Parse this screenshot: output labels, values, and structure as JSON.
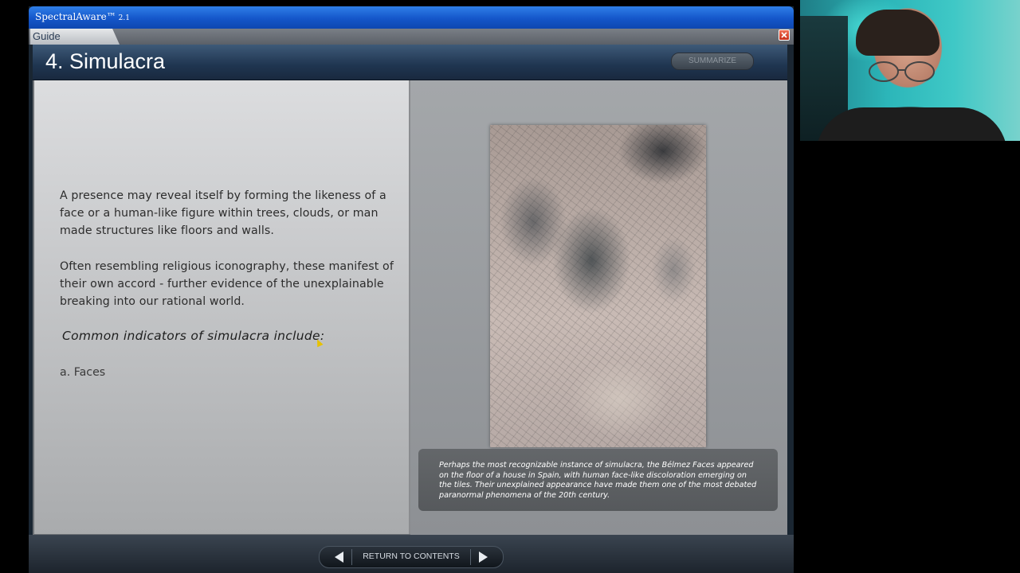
{
  "window": {
    "app_name": "SpectralAware™",
    "version": "2.1",
    "tab_label": "Guide"
  },
  "header": {
    "title": "4. Simulacra",
    "summarize_label": "SUMMARIZE"
  },
  "content": {
    "paragraph_1": "A presence may reveal itself by forming the likeness of a face or a human-like figure within trees, clouds, or man made structures like floors and walls.",
    "paragraph_2": "Often resembling religious iconography, these manifest of their own accord - further evidence of the unexplainable breaking into our rational world.",
    "indicators_heading": "Common indicators of simulacra include:",
    "indicators": [
      "a. Faces"
    ]
  },
  "media": {
    "image_caption": "Perhaps the most recognizable instance of simulacra, the Bélmez Faces appeared on the floor of a house in Spain, with human face-like discoloration emerging on the tiles. Their unexplained appearance have made them one of the most debated paranormal phenomena of the 20th century."
  },
  "footer": {
    "return_label": "RETURN TO CONTENTS"
  },
  "colors": {
    "titlebar": "#1456c9",
    "header": "#1f3550",
    "close": "#d8401f"
  },
  "icons": {
    "prev": "triangle-left-icon",
    "next": "triangle-right-icon",
    "close": "close-icon"
  }
}
